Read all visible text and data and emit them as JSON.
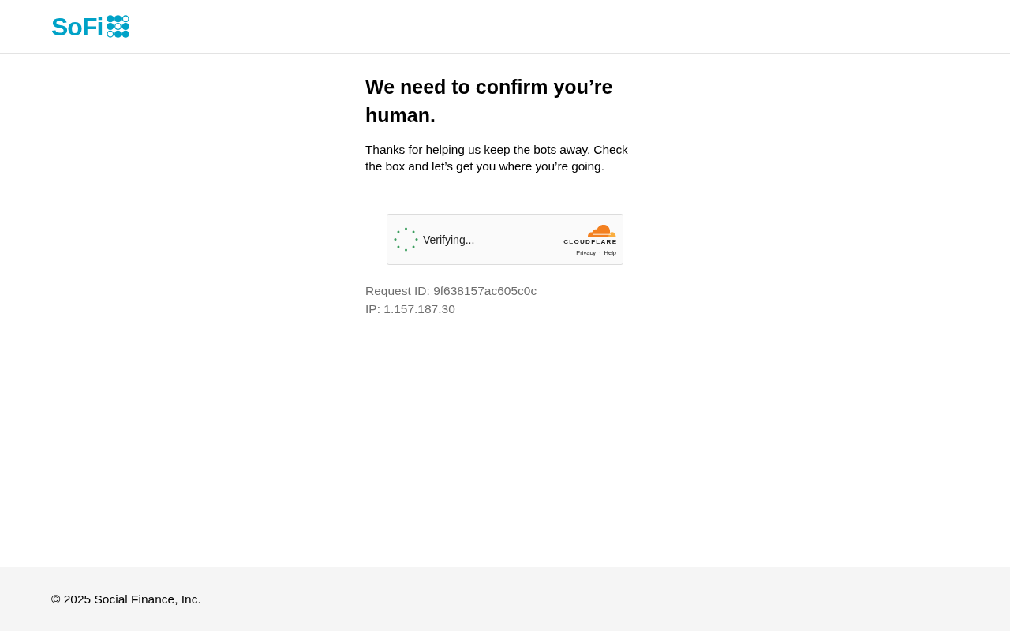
{
  "header": {
    "logo": {
      "wordmark": "SoFi"
    }
  },
  "heading": "We need to confirm you’re human.",
  "intro": "Thanks for helping us keep the bots away. Check the box and let’s get you where you’re going.",
  "challenge_widget": {
    "status": "Verifying...",
    "brand": "CLOUDFLARE",
    "links": [
      "Privacy",
      "Help"
    ],
    "separator": "·"
  },
  "request_info": [
    "Request ID: 9f638157ac605c0c",
    "IP: 1.157.187.30"
  ],
  "footer": {
    "copyright": "© 2025 Social Finance, Inc."
  }
}
